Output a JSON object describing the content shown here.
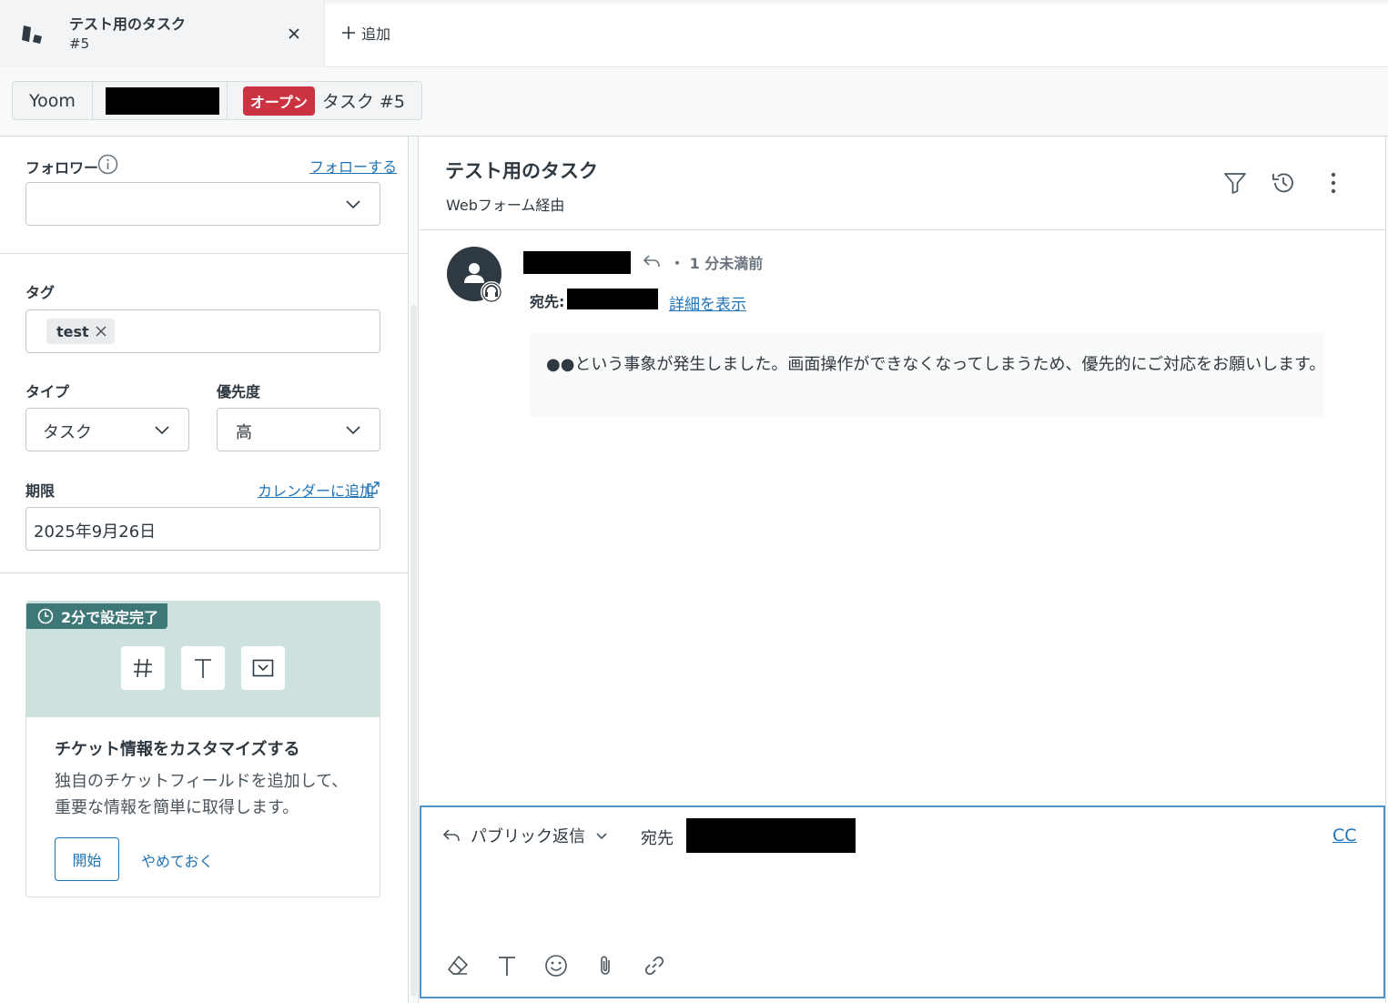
{
  "tabs": {
    "active_title": "テスト用のタスク",
    "active_subtitle": "#5",
    "add_label": "追加"
  },
  "breadcrumb": {
    "org": "Yoom",
    "status": "オープン",
    "ticket": "タスク #5"
  },
  "sidebar": {
    "followers_label": "フォロワー",
    "follow_link": "フォローする",
    "followers_value": "",
    "tags_label": "タグ",
    "tags": [
      "test"
    ],
    "type_label": "タイプ",
    "type_value": "タスク",
    "priority_label": "優先度",
    "priority_value": "高",
    "due_label": "期限",
    "calendar_link": "カレンダーに追加",
    "due_value": "2025年9月26日"
  },
  "promo": {
    "badge": "2分で設定完了",
    "title": "チケット情報をカスタマイズする",
    "body": "独自のチケットフィールドを追加して、重要な情報を簡単に取得します。",
    "start_button": "開始",
    "skip_link": "やめておく",
    "icons": [
      "hash-icon",
      "text-icon",
      "dropdown-icon"
    ]
  },
  "conversation": {
    "title": "テスト用のタスク",
    "channel": "Webフォーム経由",
    "message": {
      "time": "・ 1 分未満前",
      "to_label": "宛先:",
      "details_link": "詳細を表示",
      "body": "●●という事象が発生しました。画面操作ができなくなってしまうため、優先的にご対応をお願いします。"
    }
  },
  "composer": {
    "reply_type": "パブリック返信",
    "to_label": "宛先",
    "cc_label": "CC",
    "tools": [
      "eraser-icon",
      "text-format-icon",
      "emoji-icon",
      "attachment-icon",
      "link-icon"
    ]
  },
  "colors": {
    "accent": "#1f73b7",
    "status_open": "#cc3340",
    "promo_bg": "#cde2de",
    "promo_badge": "#3e7777"
  }
}
